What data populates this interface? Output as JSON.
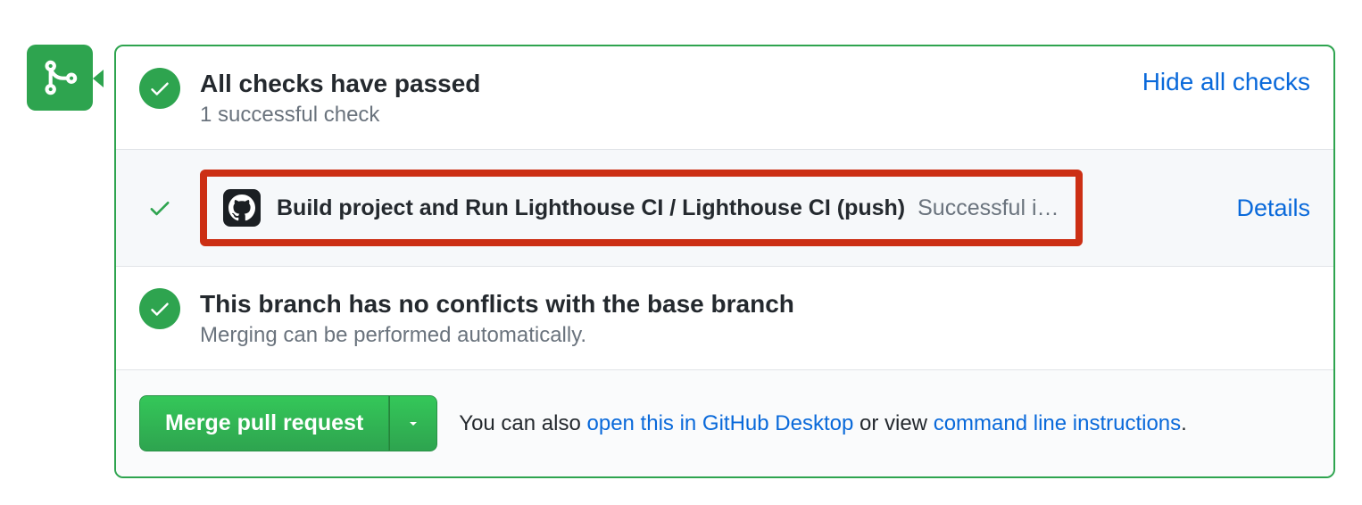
{
  "checks": {
    "title": "All checks have passed",
    "subtitle": "1 successful check",
    "toggle_link": "Hide all checks",
    "items": [
      {
        "name": "Build project and Run Lighthouse CI / Lighthouse CI (push)",
        "status": "Successful i…",
        "details_label": "Details"
      }
    ]
  },
  "conflicts": {
    "title": "This branch has no conflicts with the base branch",
    "subtitle": "Merging can be performed automatically."
  },
  "merge": {
    "button_label": "Merge pull request",
    "hint_prefix": "You can also ",
    "desktop_link": "open this in GitHub Desktop",
    "hint_mid": " or view ",
    "cli_link": "command line instructions",
    "hint_suffix": "."
  }
}
